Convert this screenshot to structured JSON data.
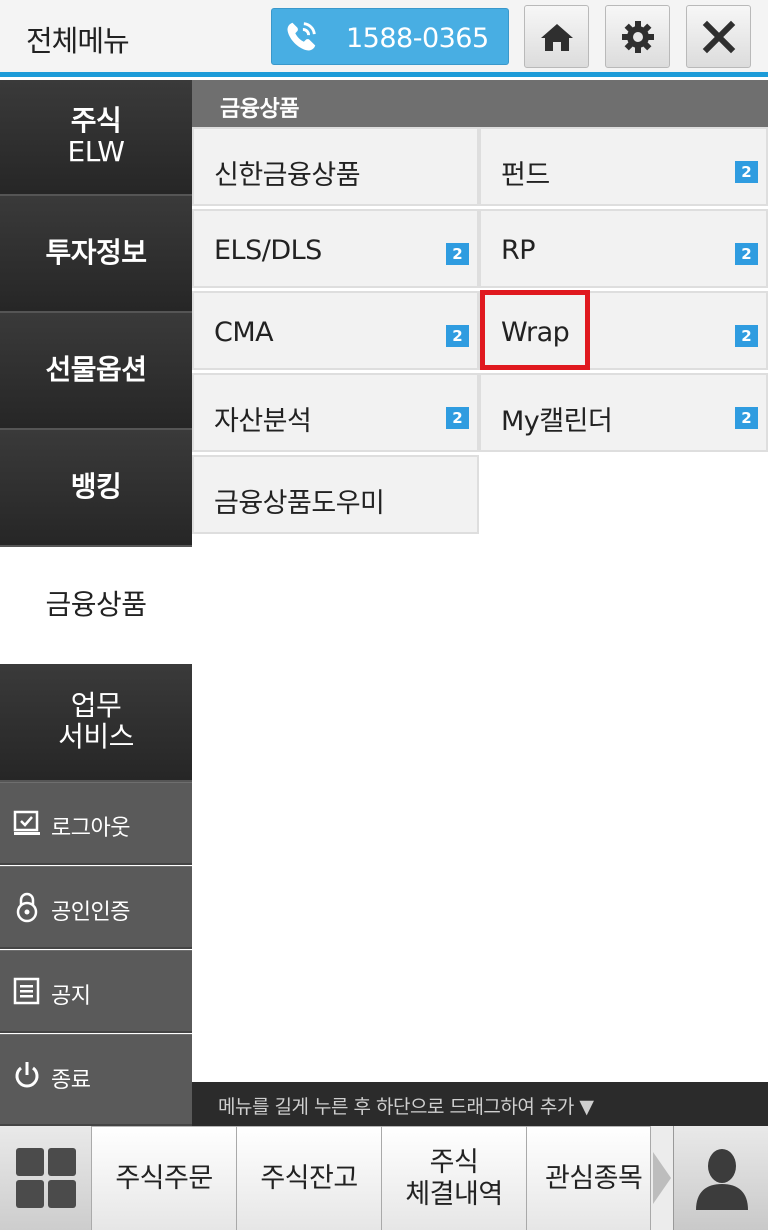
{
  "header": {
    "title": "전체메뉴",
    "phone_number": "1588-0365",
    "home_icon": "home-icon",
    "settings_icon": "gear-icon",
    "close_icon": "close-icon",
    "accent_color": "#1d9bd8"
  },
  "left_menu": {
    "items": [
      {
        "label_line1": "주식",
        "label_line2": "ELW"
      },
      {
        "label": "투자정보"
      },
      {
        "label": "선물옵션"
      },
      {
        "label": "뱅킹"
      },
      {
        "label": "금융상품",
        "active": true
      },
      {
        "label_line1": "업무",
        "label_line2": "서비스"
      }
    ],
    "system_items": [
      {
        "label": "로그아웃",
        "icon": "logout-icon"
      },
      {
        "label": "공인인증",
        "icon": "lock-icon"
      },
      {
        "label": "공지",
        "icon": "notice-icon"
      },
      {
        "label": "종료",
        "icon": "power-icon"
      }
    ]
  },
  "submenu": {
    "title": "금융상품",
    "items": [
      {
        "label": "신한금융상품",
        "badge": ""
      },
      {
        "label": "펀드",
        "badge": "2"
      },
      {
        "label": "ELS/DLS",
        "badge": "2"
      },
      {
        "label": "RP",
        "badge": "2"
      },
      {
        "label": "CMA",
        "badge": "2"
      },
      {
        "label": "Wrap",
        "badge": "2",
        "highlighted": true
      },
      {
        "label": "자산분석",
        "badge": "2"
      },
      {
        "label": "My캘린더",
        "badge": "2"
      },
      {
        "label": "금융상품도우미",
        "badge": ""
      }
    ],
    "highlight_color": "#e0191f"
  },
  "hint": "메뉴를 길게 누른 후 하단으로 드래그하여 추가 ▼",
  "bottom_bar": {
    "grid_icon": "grid-icon",
    "tabs": [
      {
        "label": "주식주문"
      },
      {
        "label": "주식잔고"
      },
      {
        "label_line1": "주식",
        "label_line2": "체결내역"
      },
      {
        "label": "관심종목"
      }
    ],
    "arrow_icon": "chevron-right-icon",
    "user_icon": "user-icon"
  }
}
